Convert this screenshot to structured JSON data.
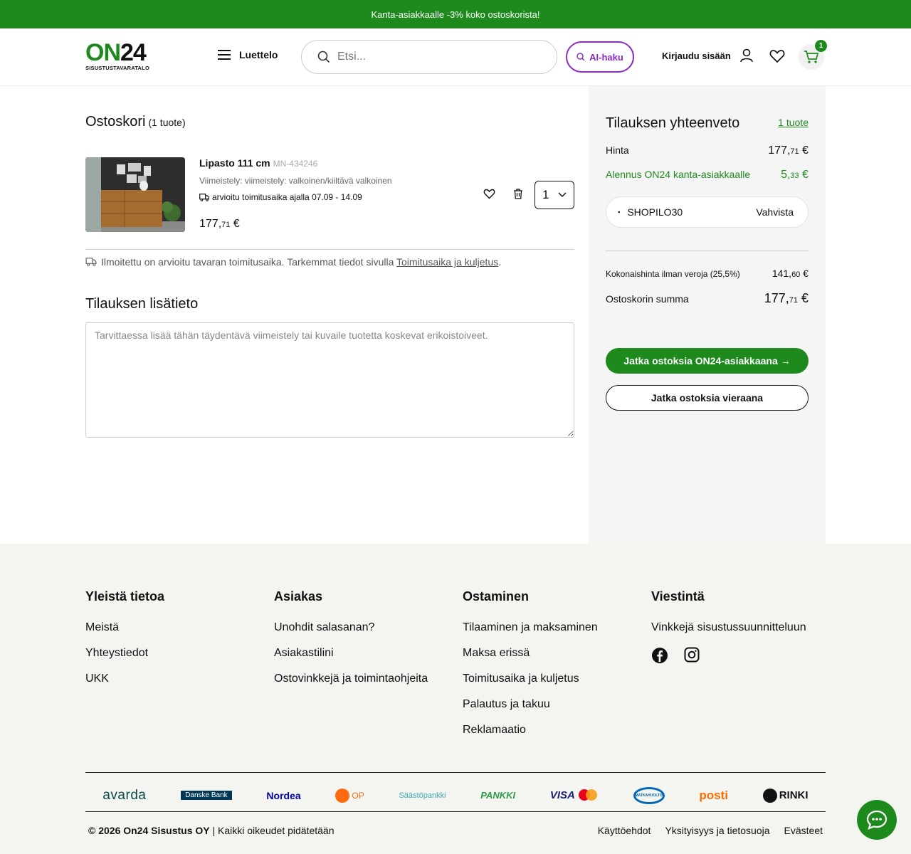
{
  "promo": {
    "text": "Kanta-asiakkaalle -3% koko ostoskorista!"
  },
  "header": {
    "logo_main": "ON24",
    "logo_sub": "SISUSTUSTAVARATALO",
    "menu_label": "Luettelo",
    "search_placeholder": "Etsi...",
    "ai_label": "AI-haku",
    "login_label": "Kirjaudu sisään",
    "cart_count": "1"
  },
  "cart": {
    "title": "Ostoskori",
    "count_label": "(1 tuote)",
    "item": {
      "name": "Lipasto 111 cm",
      "sku": "MN-434246",
      "finish": "Viimeistely: viimeistely: valkoinen/kiiltävä valkoinen",
      "delivery": "arvioitu toimitusaika ajalla 07.09 - 14.09",
      "price_main": "177,",
      "price_cents": "71",
      "price_currency": " €",
      "quantity": "1"
    },
    "notice_text": "Ilmoitettu on arvioitu tavaran toimitusaika. Tarkemmat tiedot sivulla ",
    "notice_link": "Toimitusaika ja kuljetus",
    "notice_end": ".",
    "extra_title": "Tilauksen lisätieto",
    "extra_placeholder": "Tarvittaessa lisää tähän täydentävä viimeistely tai kuvaile tuotetta koskevat erikoistoiveet."
  },
  "summary": {
    "title": "Tilauksen yhteenveto",
    "count_link": "1 tuote",
    "price_label": "Hinta",
    "price_main": "177,",
    "price_cents": "71",
    "discount_label": "Alennus ON24 kanta-asiakkaalle",
    "discount_main": "5,",
    "discount_cents": "33",
    "coupon_value": "SHOPILO30",
    "coupon_apply": "Vahvista",
    "net_label": "Kokonaishinta ilman veroja (25,5%)",
    "net_main": "141,",
    "net_cents": "60",
    "total_label": "Ostoskorin summa",
    "total_main": "177,",
    "total_cents": "71",
    "currency": " €",
    "primary_button": "Jatka ostoksia ON24-asiakkaana →",
    "secondary_button": "Jatka ostoksia vieraana"
  },
  "footer": {
    "columns": [
      {
        "title": "Yleistä tietoa",
        "links": [
          "Meistä",
          "Yhteystiedot",
          "UKK"
        ]
      },
      {
        "title": "Asiakas",
        "links": [
          "Unohdit salasanan?",
          "Asiakastilini",
          "Ostovinkkejä ja toimintaohjeita"
        ]
      },
      {
        "title": "Ostaminen",
        "links": [
          "Tilaaminen ja maksaminen",
          "Maksa erissä",
          "Toimitusaika ja kuljetus",
          "Palautus ja takuu",
          "Reklamaatio"
        ]
      },
      {
        "title": "Viestintä",
        "links": [
          "Vinkkejä sisustussuunnitteluun"
        ]
      }
    ],
    "payments": [
      "avarda",
      "Danske Bank",
      "Nordea",
      "OP",
      "Säästöpankki",
      "PANKKI",
      "VISA",
      "mastercard",
      "MATKAHUOLTO",
      "posti",
      "RINKI"
    ],
    "copyright_bold": "© 2026 On24 Sisustus OY",
    "copyright_rest": " | Kaikki oikeudet pidätetään",
    "links": [
      "Käyttöehdot",
      "Yksityisyys ja tietosuoja",
      "Evästeet"
    ]
  },
  "colors": {
    "brand_green": "#1e8a1e",
    "ai_purple": "#8a2bc2",
    "summary_bg": "#f5f5f5",
    "footer_bg": "#f4f5f1"
  }
}
